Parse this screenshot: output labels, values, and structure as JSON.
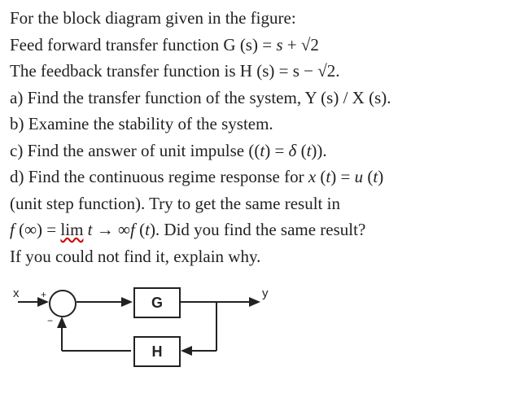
{
  "text": {
    "l1": "For the block diagram given in the figure:",
    "l2_a": "Feed forward transfer function G (s) = ",
    "l2_b": "s",
    "l2_c": " + √2",
    "l3": "The feedback transfer function is H (s) = s − √2.",
    "l4": "a) Find the transfer function of the system, Y (s) / X (s).",
    "l5": "b) Examine the stability of the system.",
    "l6_a": "c) Find the answer of unit impulse ((",
    "l6_b": "t",
    "l6_c": ") = ",
    "l6_d": "δ",
    "l6_e": " (",
    "l6_f": "t",
    "l6_g": ")).",
    "l7_a": "d) Find the continuous regime response for ",
    "l7_b": "x",
    "l7_c": " (",
    "l7_d": "t",
    "l7_e": ") = ",
    "l7_f": "u",
    "l7_g": " (",
    "l7_h": "t",
    "l7_i": ")",
    "l8": "(unit step function). Try to get the same result in",
    "l9_a": "f",
    "l9_b": " (∞) = ",
    "l9_c": "lim",
    "l9_d": " ",
    "l9_e": "t",
    "l9_f": " → ∞",
    "l9_g": "f",
    "l9_h": " (",
    "l9_i": "t",
    "l9_j": "). Did you find the same result?",
    "l10": "If you could not find it, explain why."
  },
  "diagram": {
    "x_label": "x",
    "y_label": "y",
    "g_label": "G",
    "h_label": "H",
    "plus": "+",
    "minus": "−"
  }
}
